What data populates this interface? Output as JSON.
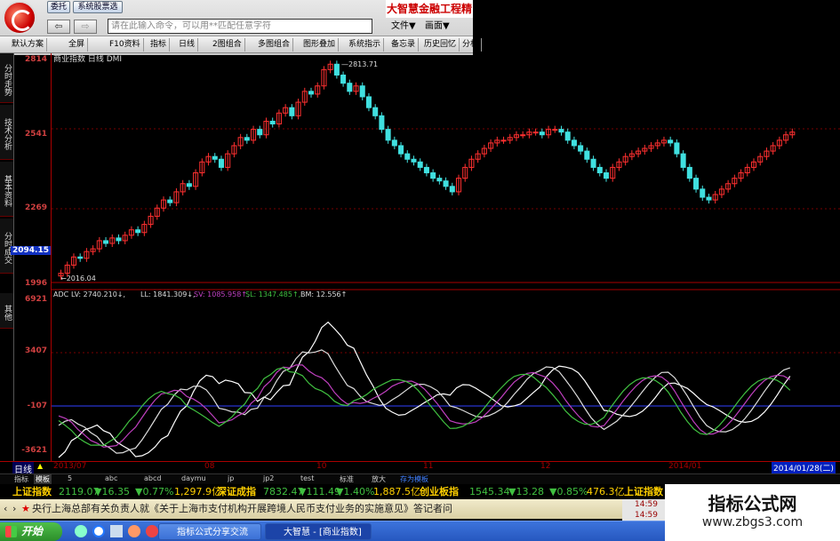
{
  "titlebar": {
    "btn_guard": "委托",
    "btn_system": "系统股票选",
    "brand": "大智慧金融工程精",
    "cmd_placeholder": "请在此输入命令，可以用**匹配任意字符",
    "menu_file": "文件▼",
    "menu_view": "画面▼"
  },
  "toolbar": [
    "默认方案",
    "全屏",
    "F10资料",
    "指标",
    "日线",
    "2图组合",
    "多图组合",
    "图形叠加",
    "系统指示",
    "备忘录",
    "历史回忆",
    "分析"
  ],
  "side_tabs": [
    "分时走势",
    "技术分析",
    "基本资料",
    "分时成交",
    "其他"
  ],
  "main": {
    "legend": "商业指数 日线 DMI",
    "y_labels": [
      "2814",
      "2541",
      "2269",
      "2094.15",
      "1996"
    ],
    "peak_label": "—2813.71",
    "low_label": "←2016.04"
  },
  "indicator": {
    "legend": {
      "name": "ADC",
      "lv": "LV: 2740.210↓,",
      "ll": "LL: 1841.309↓,",
      "sv": "SV: 1085.958↑,",
      "sl": "SL: 1347.485↑,",
      "bm": "BM: 12.556↑"
    },
    "y_labels": [
      "6921",
      "3407",
      "-107",
      "-3621"
    ]
  },
  "timeaxis": {
    "period": "日线",
    "labels": [
      "2013/07",
      "08",
      "10",
      "11",
      "12",
      "2014/01"
    ],
    "current": "2014/01/28(二)"
  },
  "indtabs": [
    "指标",
    "模板",
    "5",
    "abc",
    "abcd",
    "daymu",
    "jp",
    "jp2",
    "test",
    "标准",
    "放大",
    "存为模板"
  ],
  "ticker": [
    {
      "name": "上证指数",
      "v": "2119.07",
      "d": "▼16.35",
      "p": "▼0.77%",
      "a": "1,297.9亿"
    },
    {
      "name": "深证成指",
      "v": "7832.47",
      "d": "▼111.49",
      "p": "▼1.40%",
      "a": "1,887.5亿"
    },
    {
      "name": "创业板指",
      "v": "1545.34",
      "d": "▼13.28",
      "p": "▼0.85%",
      "a": "476.3亿"
    },
    {
      "name": "上证指数",
      "v": "",
      "d": "",
      "p": "",
      "a": ""
    }
  ],
  "news": "央行上海总部有关负责人就《关于上海市支付机构开展跨境人民币支付业务的实施意见》答记者问",
  "clock": [
    "14:59",
    "14:59"
  ],
  "taskbar": {
    "start": "开始",
    "items": [
      "指标公式分享交流",
      "大智慧 - [商业指数]"
    ]
  },
  "watermark": {
    "title": "指标公式网",
    "url": "www.zbgs3.com"
  },
  "colors": {
    "up": "#ff3030",
    "down": "#40e0e0",
    "bg": "#000000",
    "grid": "#a00000"
  },
  "chart_data": {
    "type": "candlestick",
    "y_range": [
      1996,
      2814
    ],
    "closes": [
      2030,
      2060,
      2090,
      2085,
      2110,
      2120,
      2150,
      2140,
      2160,
      2150,
      2170,
      2190,
      2180,
      2210,
      2240,
      2270,
      2300,
      2290,
      2330,
      2360,
      2350,
      2400,
      2440,
      2460,
      2450,
      2420,
      2470,
      2500,
      2530,
      2520,
      2560,
      2540,
      2590,
      2580,
      2620,
      2640,
      2610,
      2660,
      2700,
      2690,
      2720,
      2780,
      2800,
      2760,
      2730,
      2700,
      2720,
      2680,
      2640,
      2610,
      2560,
      2520,
      2500,
      2470,
      2450,
      2440,
      2420,
      2400,
      2380,
      2370,
      2350,
      2330,
      2380,
      2420,
      2450,
      2470,
      2490,
      2510,
      2520,
      2520,
      2530,
      2540,
      2540,
      2550,
      2550,
      2540,
      2560,
      2560,
      2550,
      2520,
      2500,
      2480,
      2450,
      2420,
      2400,
      2380,
      2420,
      2440,
      2460,
      2470,
      2480,
      2490,
      2500,
      2510,
      2520,
      2510,
      2470,
      2420,
      2380,
      2340,
      2310,
      2300,
      2320,
      2340,
      2360,
      2380,
      2400,
      2420,
      2440,
      2460,
      2480,
      2500,
      2520,
      2540,
      2550
    ]
  }
}
